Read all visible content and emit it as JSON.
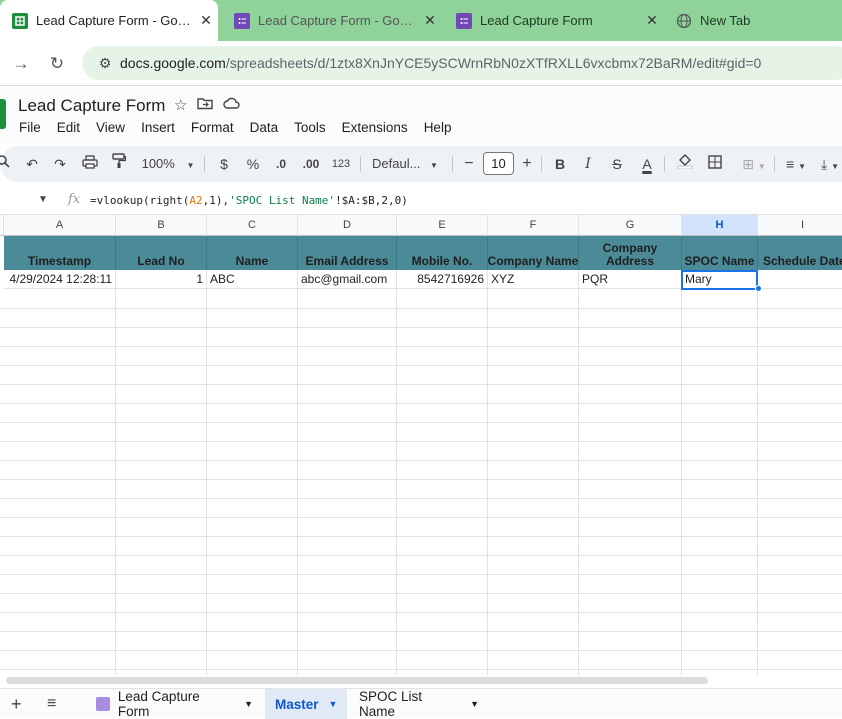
{
  "browser": {
    "tabs": [
      {
        "title": "Lead Capture Form - Google Sheets",
        "active": true,
        "icon": "sheets-icon"
      },
      {
        "title": "Lead Capture Form - Google Forms",
        "active": false,
        "icon": "forms-icon"
      },
      {
        "title": "Lead Capture Form",
        "active": false,
        "icon": "forms-icon"
      },
      {
        "title": "New Tab",
        "active": false,
        "icon": "globe-icon"
      }
    ],
    "url_host": "docs.google.com",
    "url_path": "/spreadsheets/d/1ztx8XnJnYCE5ySCWrnRbN0zXTfRXLL6vxcbmx72BaRM/edit#gid=0"
  },
  "doc": {
    "title": "Lead Capture Form",
    "menu": [
      "File",
      "Edit",
      "View",
      "Insert",
      "Format",
      "Data",
      "Tools",
      "Extensions",
      "Help"
    ]
  },
  "toolbar": {
    "zoom": "100%",
    "currency": "$",
    "percent": "%",
    "dec_decrease": ".0",
    "dec_increase": ".00",
    "number_format": "123",
    "font": "Defaul...",
    "font_size": "10",
    "bold": "B",
    "italic": "I",
    "strike": "S",
    "text_color": "A"
  },
  "formula_bar": {
    "fx": "fx",
    "prefix": "=vlookup(right(",
    "ref": "A2",
    "mid": ",1),",
    "string": "'SPOC List Name'",
    "suffix": "!$A:$B,2,0)"
  },
  "columns": [
    "A",
    "B",
    "C",
    "D",
    "E",
    "F",
    "G",
    "H",
    "I"
  ],
  "selected_column": "H",
  "header_row": [
    "Timestamp",
    "Lead No",
    "Name",
    "Email Address",
    "Mobile No.",
    "Company Name",
    "Company Address",
    "SPOC Name",
    "Schedule Date"
  ],
  "data_row": [
    "4/29/2024 12:28:11",
    "1",
    "ABC",
    "abc@gmail.com",
    "8542716926",
    "XYZ",
    "PQR",
    "Mary",
    ""
  ],
  "sheets": [
    {
      "name": "Lead Capture Form",
      "active": false,
      "icon": "forms-icon"
    },
    {
      "name": "Master",
      "active": true
    },
    {
      "name": "SPOC List Name",
      "active": false
    }
  ],
  "colors": {
    "tab_strip": "#8fd39a",
    "header_fill": "#4b8a97",
    "selection": "#1a73e8"
  }
}
